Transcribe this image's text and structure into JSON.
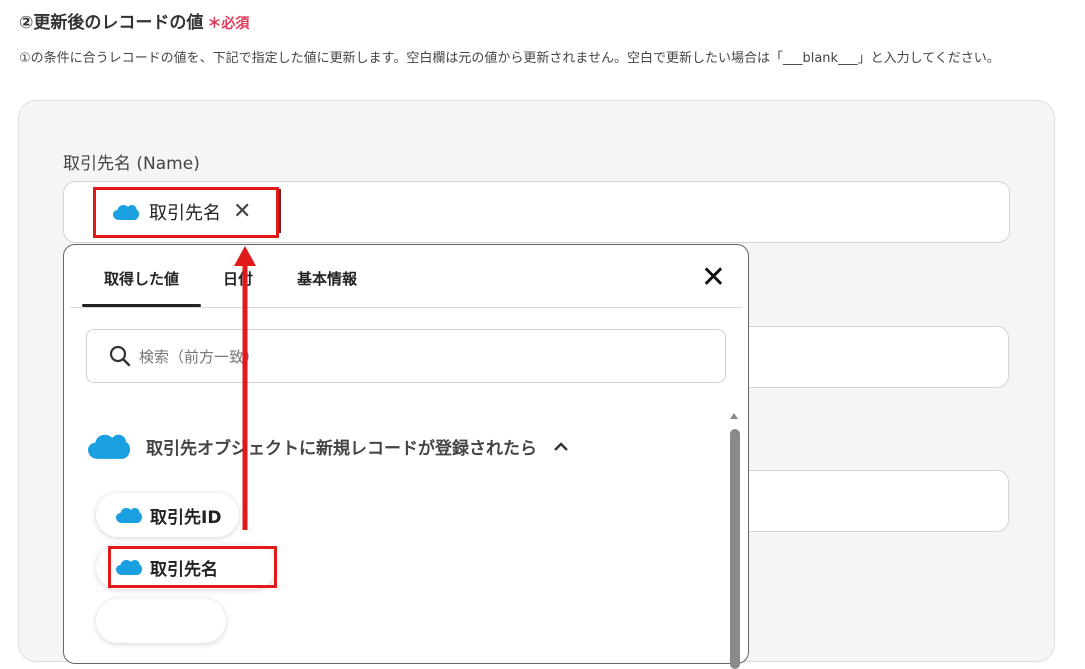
{
  "section": {
    "title": "②更新後のレコードの値",
    "required": "＊必須",
    "description": "①の条件に合うレコードの値を、下記で指定した値に更新します。空白欄は元の値から更新されません。空白で更新したい場合は「___blank___」と入力してください。"
  },
  "field": {
    "label": "取引先名 (Name)",
    "chip_label": "取引先名"
  },
  "dropdown": {
    "tabs": [
      {
        "label": "取得した値",
        "active": true
      },
      {
        "label": "日付",
        "active": false
      },
      {
        "label": "基本情報",
        "active": false
      }
    ],
    "search_placeholder": "検索（前方一致）",
    "group_label": "取引先オブジェクトに新規レコードが登録されたら",
    "items": [
      {
        "label": "取引先ID"
      },
      {
        "label": "取引先名"
      }
    ]
  },
  "icons": {
    "brand": "salesforce-cloud-icon",
    "close": "close-icon",
    "search": "search-icon",
    "chevron": "chevron-up-icon"
  },
  "colors": {
    "salesforce": "#1aa0e0",
    "required": "#e23a5a",
    "highlight": "#e01919"
  }
}
